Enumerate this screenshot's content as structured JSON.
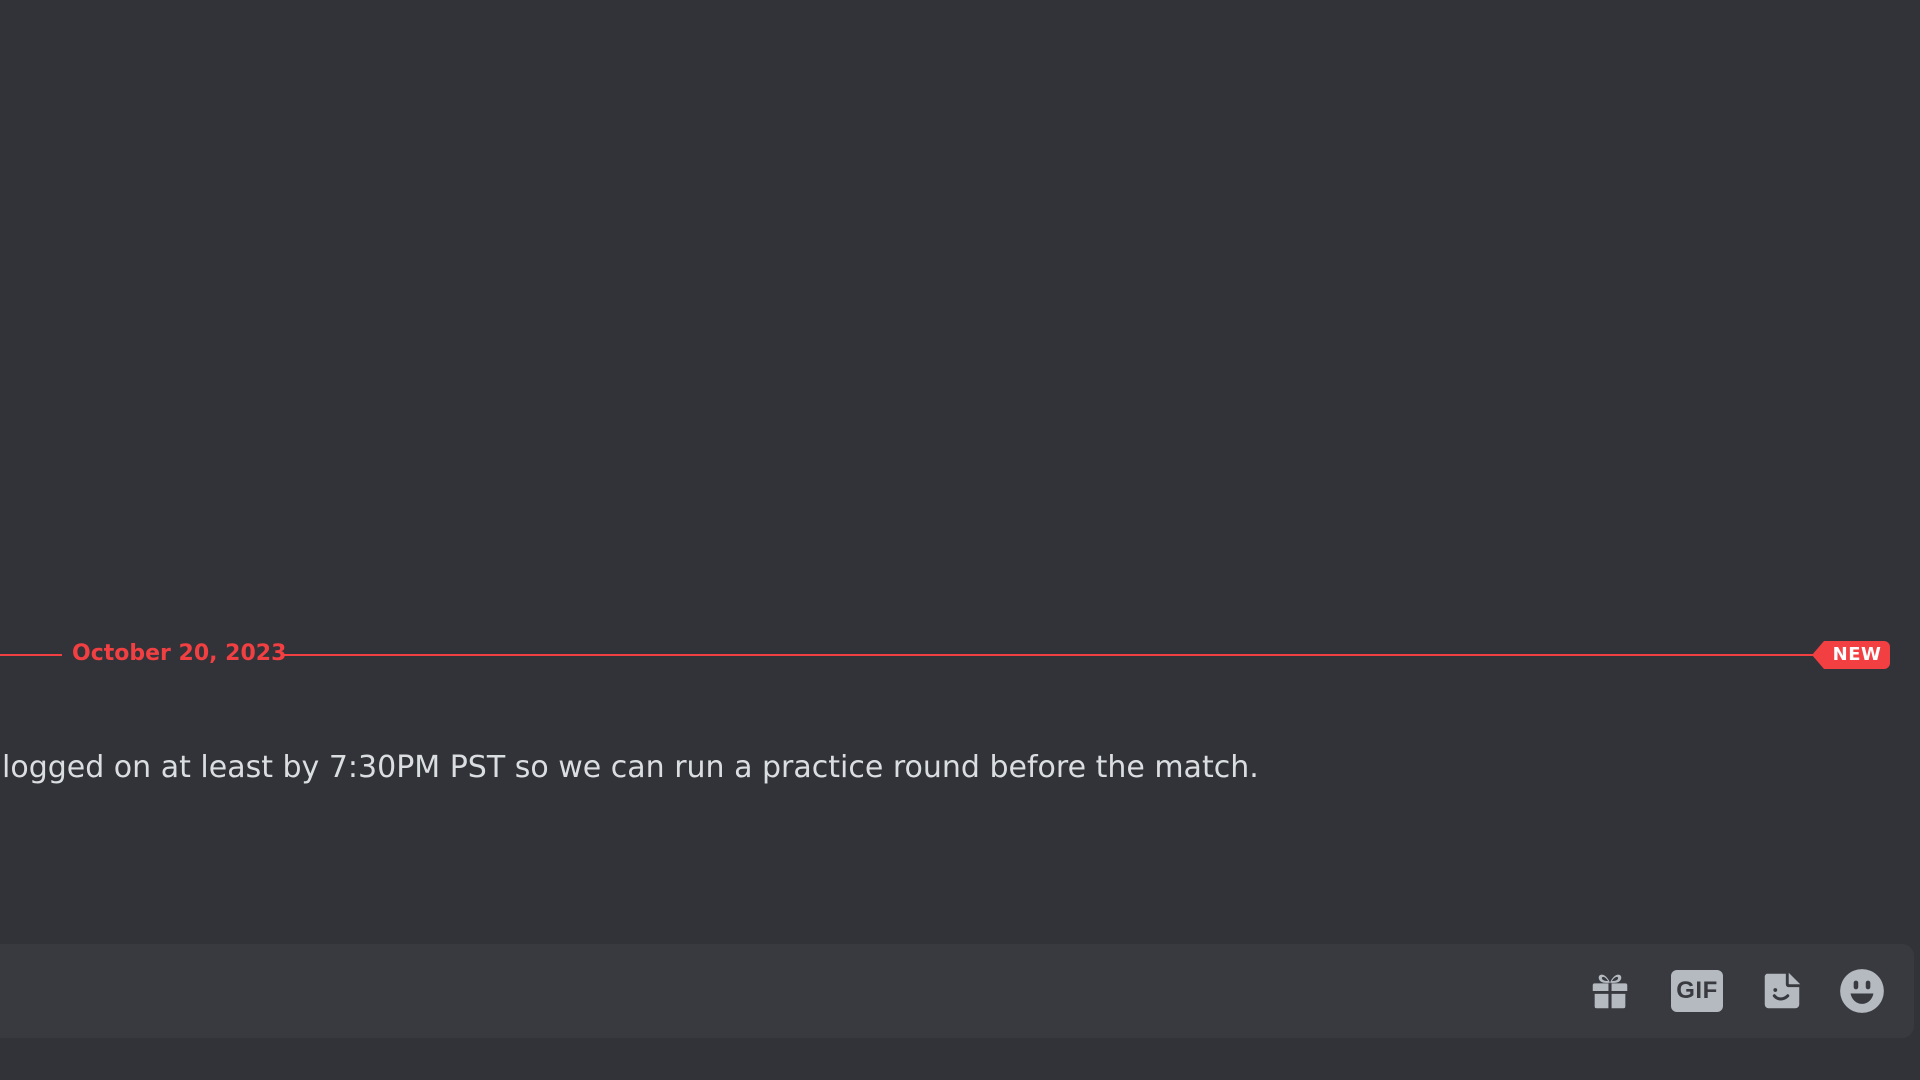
{
  "divider": {
    "date": "October 20, 2023",
    "new_label": "NEW"
  },
  "message": {
    "text": "logged on at least by 7:30PM PST so we can run a practice round before the match."
  },
  "composer": {
    "placeholder": "",
    "gif_label": "GIF"
  },
  "icons": {
    "gift": "gift-icon",
    "gif": "gif-icon",
    "sticker": "sticker-icon",
    "emoji": "emoji-icon"
  },
  "colors": {
    "background": "#313338",
    "composer_bg": "#383a40",
    "accent_red": "#f23f42",
    "text": "#dbdee1",
    "icon": "#b5bac1"
  }
}
